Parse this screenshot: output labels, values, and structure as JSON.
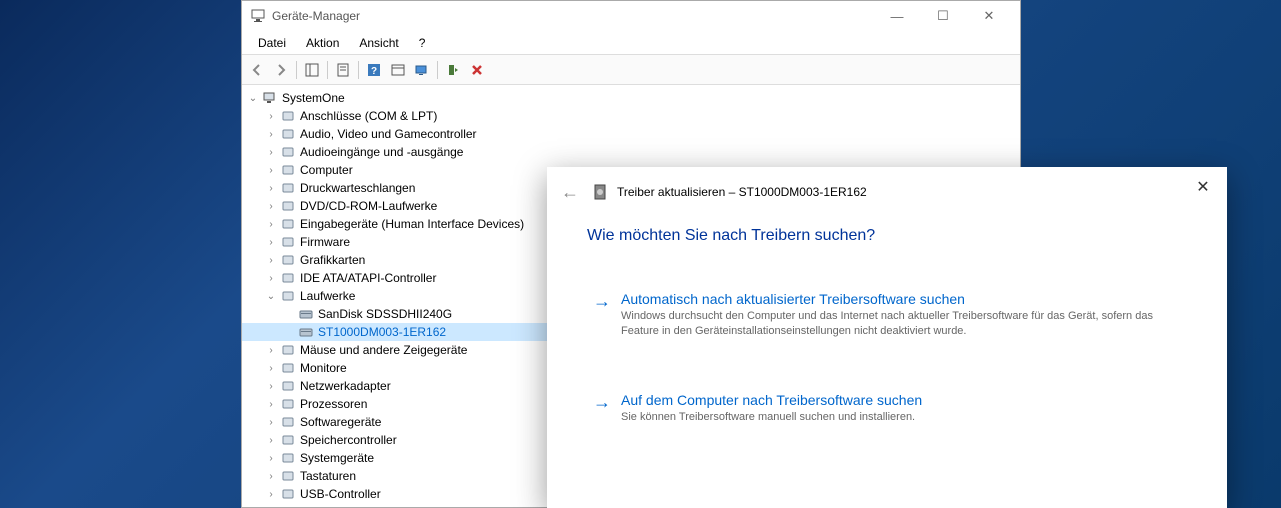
{
  "window": {
    "title": "Geräte-Manager"
  },
  "menubar": {
    "file": "Datei",
    "action": "Aktion",
    "view": "Ansicht",
    "help": "?"
  },
  "tree": {
    "root": "SystemOne",
    "nodes": [
      {
        "label": "Anschlüsse (COM & LPT)",
        "toggle": "›"
      },
      {
        "label": "Audio, Video und Gamecontroller",
        "toggle": "›"
      },
      {
        "label": "Audioeingänge und -ausgänge",
        "toggle": "›"
      },
      {
        "label": "Computer",
        "toggle": "›"
      },
      {
        "label": "Druckwarteschlangen",
        "toggle": "›"
      },
      {
        "label": "DVD/CD-ROM-Laufwerke",
        "toggle": "›"
      },
      {
        "label": "Eingabegeräte (Human Interface Devices)",
        "toggle": "›"
      },
      {
        "label": "Firmware",
        "toggle": "›"
      },
      {
        "label": "Grafikkarten",
        "toggle": "›"
      },
      {
        "label": "IDE ATA/ATAPI-Controller",
        "toggle": "›"
      },
      {
        "label": "Laufwerke",
        "toggle": "⌄",
        "expanded": true,
        "children": [
          {
            "label": "SanDisk SDSSDHII240G"
          },
          {
            "label": "ST1000DM003-1ER162",
            "selected": true
          }
        ]
      },
      {
        "label": "Mäuse und andere Zeigegeräte",
        "toggle": "›"
      },
      {
        "label": "Monitore",
        "toggle": "›"
      },
      {
        "label": "Netzwerkadapter",
        "toggle": "›"
      },
      {
        "label": "Prozessoren",
        "toggle": "›"
      },
      {
        "label": "Softwaregeräte",
        "toggle": "›"
      },
      {
        "label": "Speichercontroller",
        "toggle": "›"
      },
      {
        "label": "Systemgeräte",
        "toggle": "›"
      },
      {
        "label": "Tastaturen",
        "toggle": "›"
      },
      {
        "label": "USB-Controller",
        "toggle": "›"
      }
    ]
  },
  "dialog": {
    "title": "Treiber aktualisieren – ST1000DM003-1ER162",
    "heading": "Wie möchten Sie nach Treibern suchen?",
    "option1": {
      "title": "Automatisch nach aktualisierter Treibersoftware suchen",
      "desc": "Windows durchsucht den Computer und das Internet nach aktueller Treibersoftware für das Gerät, sofern das Feature in den Geräteinstallationseinstellungen nicht deaktiviert wurde."
    },
    "option2": {
      "title": "Auf dem Computer nach Treibersoftware suchen",
      "desc": "Sie können Treibersoftware manuell suchen und installieren."
    }
  }
}
